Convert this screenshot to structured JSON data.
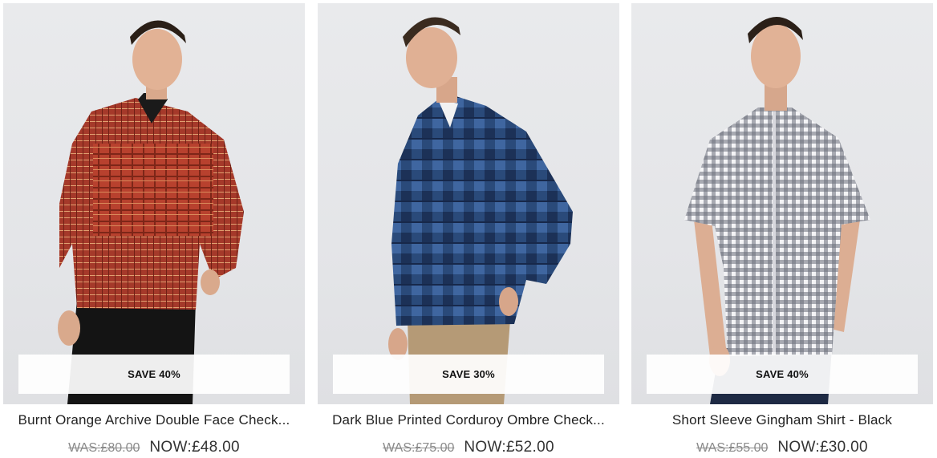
{
  "products": [
    {
      "image_alt": "Burnt Orange Archive Double Face Check shirt",
      "badge": "SAVE 40%",
      "title": "Burnt Orange Archive Double Face Check...",
      "was_price": "WAS:£80.00",
      "now_price": "NOW:£48.00"
    },
    {
      "image_alt": "Dark Blue Printed Corduroy Ombre Check shirt",
      "badge": "SAVE 30%",
      "title": "Dark Blue Printed Corduroy Ombre Check...",
      "was_price": "WAS:£75.00",
      "now_price": "NOW:£52.00"
    },
    {
      "image_alt": "Short Sleeve Gingham Shirt - Black",
      "badge": "SAVE 40%",
      "title": "Short Sleeve Gingham Shirt - Black",
      "was_price": "WAS:£55.00",
      "now_price": "NOW:£30.00"
    }
  ],
  "colors": {
    "photo_background": "#e6e7ea",
    "badge_background": "#ffffff",
    "text": "#222222",
    "was_price": "#8a8a8a"
  }
}
